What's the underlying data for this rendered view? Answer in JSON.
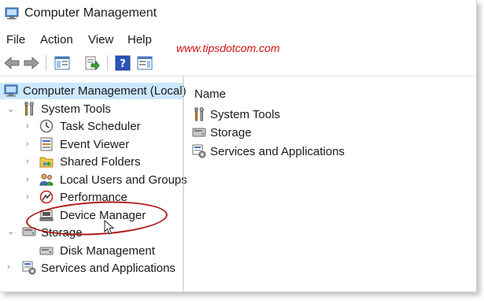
{
  "window": {
    "title": "Computer Management"
  },
  "menu": [
    "File",
    "Action",
    "View",
    "Help"
  ],
  "toolbar": {
    "buttons": [
      {
        "name": "back-button",
        "icon": "arrow-left-icon"
      },
      {
        "name": "forward-button",
        "icon": "arrow-right-icon"
      },
      {
        "name": "show-hide-console-tree-button",
        "icon": "console-tree-icon"
      },
      {
        "name": "export-list-button",
        "icon": "export-icon"
      },
      {
        "name": "help-button",
        "icon": "help-icon"
      },
      {
        "name": "show-hide-action-pane-button",
        "icon": "action-pane-icon"
      }
    ]
  },
  "watermark": "www.tipsdotcom.com",
  "tree": {
    "root": "Computer Management (Local)",
    "system_tools": "System Tools",
    "task_scheduler": "Task Scheduler",
    "event_viewer": "Event Viewer",
    "shared_folders": "Shared Folders",
    "local_users": "Local Users and Groups",
    "performance": "Performance",
    "device_manager": "Device Manager",
    "storage": "Storage",
    "disk_management": "Disk Management",
    "services": "Services and Applications"
  },
  "list": {
    "column_name": "Name",
    "items": [
      "System Tools",
      "Storage",
      "Services and Applications"
    ]
  },
  "colors": {
    "selection": "#cce8ff",
    "annotation": "#b01818",
    "watermark": "#cc1111"
  }
}
